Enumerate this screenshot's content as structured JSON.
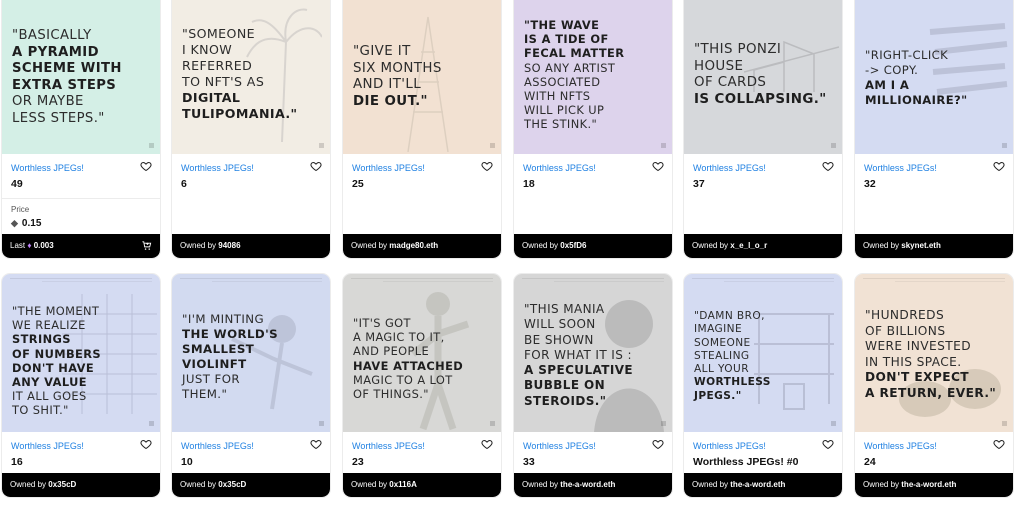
{
  "collection_label": "Worthless JPEGs!",
  "owned_prefix": "Owned by",
  "cards": [
    {
      "number": "49",
      "price_label": "Price",
      "price": "0.15",
      "last_label": "Last",
      "last": "0.003",
      "quote": [
        "\"BASICALLY",
        "A PYRAMID",
        "SCHEME WITH",
        "EXTRA STEPS",
        "OR MAYBE",
        "LESS STEPS.\""
      ]
    },
    {
      "number": "6",
      "owner": "94086",
      "quote": [
        "\"SOMEONE",
        "I KNOW",
        "REFERRED",
        "TO NFT'S AS",
        "DIGITAL",
        "TULIPOMANIA.\""
      ]
    },
    {
      "number": "25",
      "owner": "madge80.eth",
      "quote": [
        "\"GIVE IT",
        "SIX MONTHS",
        "AND IT'LL",
        "DIE OUT.\""
      ]
    },
    {
      "number": "18",
      "owner": "0x5fD6",
      "quote": [
        "\"THE WAVE",
        "IS A TIDE OF",
        "FECAL MATTER",
        "SO ANY ARTIST",
        "ASSOCIATED",
        "WITH NFTS",
        "WILL PICK UP",
        "THE STINK.\""
      ]
    },
    {
      "number": "37",
      "owner": "x_e_l_o_r",
      "quote": [
        "\"THIS PONZI",
        "HOUSE",
        "OF CARDS",
        "IS COLLAPSING.\""
      ]
    },
    {
      "number": "32",
      "owner": "skynet.eth",
      "quote": [
        "\"RIGHT-CLICK",
        "-> COPY.",
        "AM I A",
        "MILLIONAIRE?\""
      ]
    },
    {
      "number": "16",
      "owner": "0x35cD",
      "quote": [
        "\"THE MOMENT",
        "WE REALIZE",
        "STRINGS",
        "OF NUMBERS",
        "DON'T HAVE",
        "ANY VALUE",
        "IT ALL GOES",
        "TO SHIT.\""
      ]
    },
    {
      "number": "10",
      "owner": "0x35cD",
      "quote": [
        "\"I'M MINTING",
        "THE WORLD'S",
        "SMALLEST",
        "VIOLINFT",
        "JUST FOR",
        "THEM.\""
      ]
    },
    {
      "number": "23",
      "owner": "0x116A",
      "quote": [
        "\"IT'S GOT",
        "A MAGIC TO IT,",
        "AND PEOPLE",
        "HAVE ATTACHED",
        "MAGIC TO A LOT",
        "OF THINGS.\""
      ]
    },
    {
      "number": "33",
      "owner": "the-a-word.eth",
      "quote": [
        "\"THIS MANIA",
        "WILL SOON",
        "BE SHOWN",
        "FOR WHAT IT IS :",
        "A SPECULATIVE",
        "BUBBLE ON",
        "STEROIDS.\""
      ]
    },
    {
      "number": "Worthless JPEGs! #0",
      "owner": "the-a-word.eth",
      "quote": [
        "\"DAMN BRO,",
        "IMAGINE",
        "SOMEONE",
        "STEALING",
        "ALL YOUR",
        "WORTHLESS",
        "JPEGS.\""
      ]
    },
    {
      "number": "24",
      "owner": "the-a-word.eth",
      "quote": [
        "\"HUNDREDS",
        "OF BILLIONS",
        "WERE INVESTED",
        "IN THIS SPACE.",
        "DON'T EXPECT",
        "A RETURN, EVER.\""
      ]
    }
  ],
  "colors": {
    "link_blue": "#2081e2",
    "footer_black": "#000000",
    "art_mint": "#d4efe6",
    "art_cream": "#f3ebdd",
    "art_peach": "#f2e1d2",
    "art_lilac": "#dcd3ec",
    "art_gray": "#d7d9dc",
    "art_periwinkle": "#d4dbf2"
  },
  "icons": {
    "favorite": "heart-icon",
    "buy": "cart-icon",
    "currency": "ethereum-icon"
  }
}
